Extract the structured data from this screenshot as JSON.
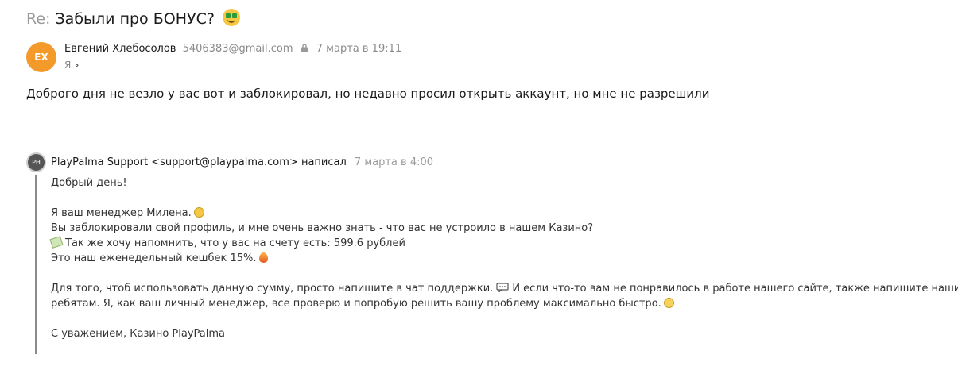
{
  "subject": {
    "prefix": "Re:",
    "title": "Забыли про БОНУС?",
    "emoji_icon": "money-mouth-face-icon"
  },
  "sender": {
    "initials": "ЕХ",
    "avatar_color": "#f39a2b",
    "name": "Евгений Хлебосолов",
    "email": "5406383@gmail.com",
    "date": "7 марта в 19:11",
    "recipient": "Я"
  },
  "message": {
    "body": "Доброго дня не везло у вас  вот и заблокировал, но недавно просил открыть аккаунт, но мне не разрешили"
  },
  "quoted": {
    "initials": "PH",
    "header": "PlayPalma Support <support@playpalma.com> написал",
    "date": "7 марта в 4:00",
    "greeting": "Добрый день!",
    "line1": "Я ваш менеджер Милена.",
    "line2": "Вы заблокировали свой профиль, и мне очень важно знать - что вас не устроило в нашем Казино?",
    "line3": "Так же хочу напомнить, что у вас на счету есть: 599.6 рублей",
    "line4": "Это наш еженедельный кешбек 15%.",
    "line5a": "Для того, чтоб использовать данную сумму, просто напишите в чат поддержки.",
    "line5b": "И если что-то вам не понравилось в работе нашего сайте, также напишите нашим",
    "line6": "ребятам. Я, как ваш личный менеджер, все проверю и попробую решить вашу проблему максимально быстро.",
    "signature": "С уважением, Казино PlayPalma"
  }
}
